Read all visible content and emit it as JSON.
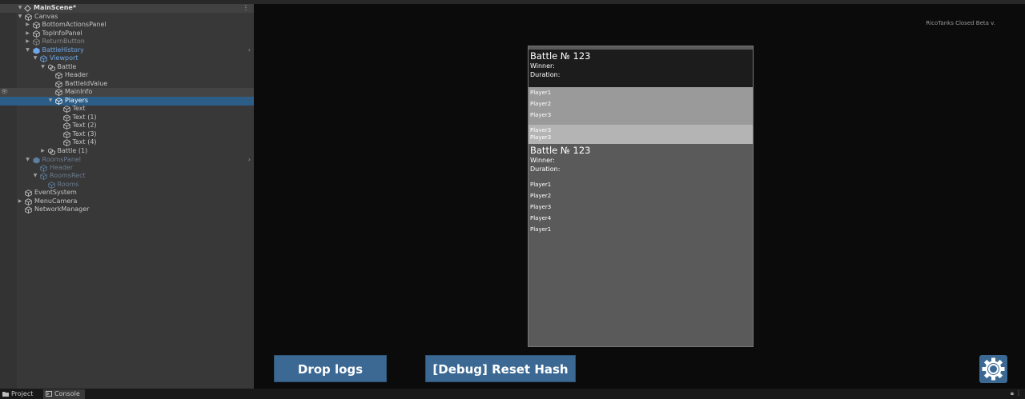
{
  "hierarchy": {
    "scene": "MainScene*",
    "items": [
      {
        "label": "Canvas"
      },
      {
        "label": "BottomActionsPanel"
      },
      {
        "label": "TopInfoPanel"
      },
      {
        "label": "ReturnButton"
      },
      {
        "label": "BattleHistory"
      },
      {
        "label": "Viewport"
      },
      {
        "label": "Battle"
      },
      {
        "label": "Header"
      },
      {
        "label": "BattleIdValue"
      },
      {
        "label": "MainInfo"
      },
      {
        "label": "Players"
      },
      {
        "label": "Text"
      },
      {
        "label": "Text (1)"
      },
      {
        "label": "Text (2)"
      },
      {
        "label": "Text (3)"
      },
      {
        "label": "Text (4)"
      },
      {
        "label": "Battle (1)"
      },
      {
        "label": "RoomsPanel"
      },
      {
        "label": "Header"
      },
      {
        "label": "RoomsRect"
      },
      {
        "label": "Rooms"
      },
      {
        "label": "EventSystem"
      },
      {
        "label": "MenuCamera"
      },
      {
        "label": "NetworkManager"
      }
    ]
  },
  "game": {
    "beta_label": "RicoTanks Closed Beta v.",
    "battles": [
      {
        "title": "Battle № 123",
        "winner": "Winner:",
        "duration": "Duration:",
        "players": [
          "Player1",
          "Player2",
          "Player3",
          "Player3",
          "Player3"
        ]
      },
      {
        "title": "Battle № 123",
        "winner": "Winner:",
        "duration": "Duration:",
        "players": [
          "Player1",
          "Player2",
          "Player3",
          "Player4",
          "Player1"
        ]
      }
    ],
    "drop_logs": "Drop logs",
    "reset_hash": "[Debug] Reset Hash"
  },
  "bottom_tabs": {
    "project": "Project",
    "console": "Console"
  },
  "colors": {
    "accent_button": "#3b6994",
    "selection": "#2c5d87",
    "prefab_blue": "#6ea8ea"
  }
}
